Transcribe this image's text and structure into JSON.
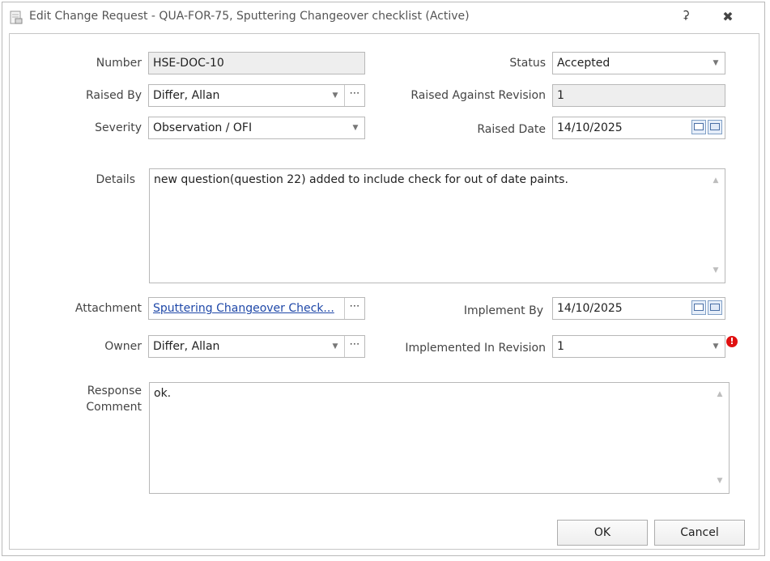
{
  "window": {
    "title": "Edit Change Request - QUA-FOR-75, Sputtering Changeover checklist (Active)"
  },
  "form": {
    "number_label": "Number",
    "number_value": "HSE-DOC-10",
    "status_label": "Status",
    "status_value": "Accepted",
    "raised_by_label": "Raised By",
    "raised_by_value": "Differ, Allan",
    "raised_against_label": "Raised Against Revision",
    "raised_against_value": "1",
    "severity_label": "Severity",
    "severity_value": "Observation / OFI",
    "raised_date_label": "Raised Date",
    "raised_date_value": "14/10/2025",
    "details_label": "Details",
    "details_value": "new question(question 22) added to include check for out of date paints.",
    "attachment_label": "Attachment",
    "attachment_value": "Sputtering Changeover Check...",
    "implement_by_label": "Implement By",
    "implement_by_value": "14/10/2025",
    "owner_label": "Owner",
    "owner_value": "Differ, Allan",
    "implemented_in_label": "Implemented In Revision",
    "implemented_in_value": "1",
    "response_label_line1": "Response",
    "response_label_line2": "Comment",
    "response_value": "ok."
  },
  "buttons": {
    "ok": "OK",
    "cancel": "Cancel"
  },
  "icons": {
    "pin": "pin-icon",
    "close": "close-icon",
    "error": "error-icon",
    "error_color": "#e01010"
  }
}
